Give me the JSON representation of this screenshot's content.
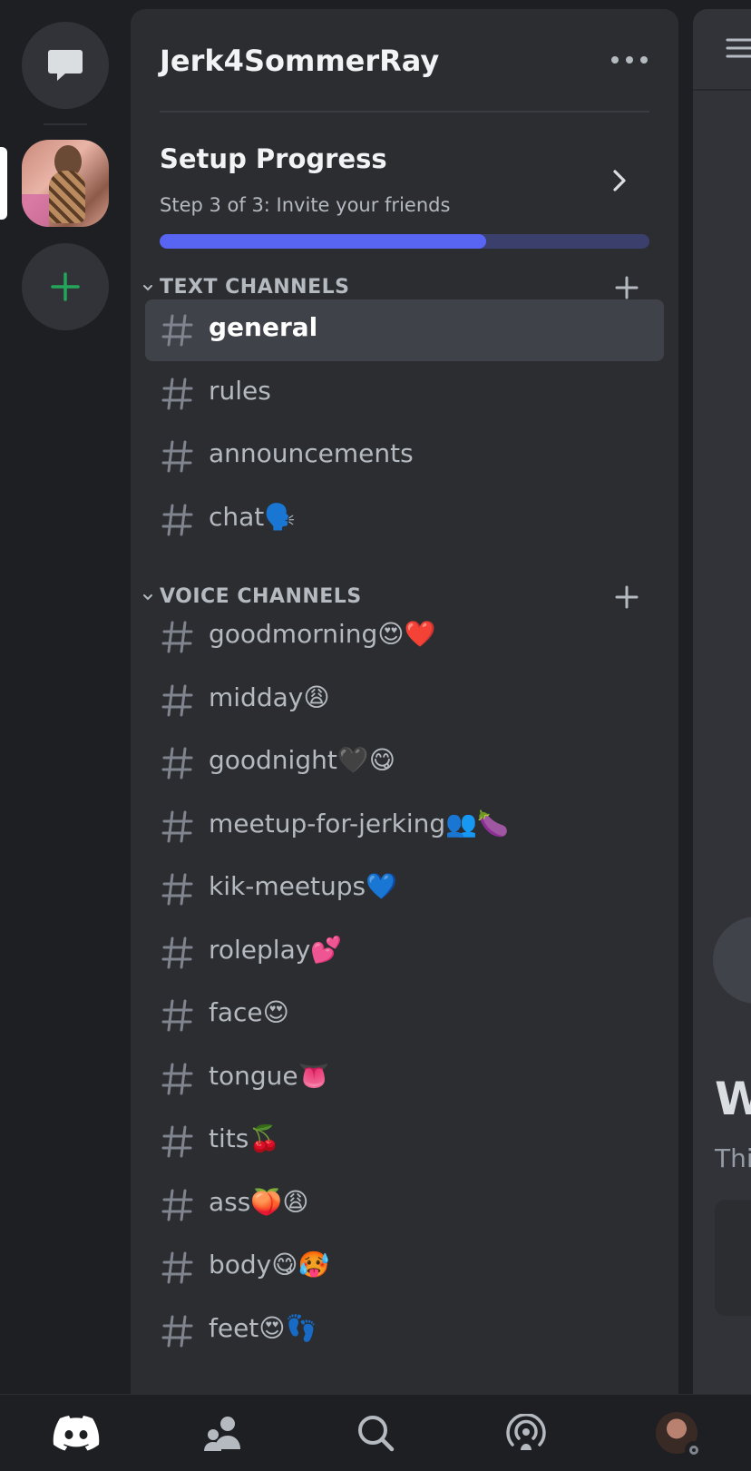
{
  "server": {
    "name": "Jerk4SommerRay",
    "setup": {
      "title": "Setup Progress",
      "subtitle": "Step 3 of 3: Invite your friends",
      "progress": 0.667
    }
  },
  "categories": {
    "text": {
      "label": "TEXT CHANNELS",
      "channels": [
        {
          "name": "general",
          "active": true
        },
        {
          "name": "rules"
        },
        {
          "name": "announcements"
        },
        {
          "name": "chat🗣️"
        }
      ]
    },
    "voice": {
      "label": "VOICE CHANNELS",
      "channels": [
        {
          "name": "goodmorning😍❤️"
        },
        {
          "name": "midday😩"
        },
        {
          "name": "goodnight🖤😋"
        },
        {
          "name": "meetup-for-jerking👥🍆"
        },
        {
          "name": "kik-meetups💙"
        },
        {
          "name": "roleplay💕"
        },
        {
          "name": "face😍"
        },
        {
          "name": "tongue👅"
        },
        {
          "name": "tits🍒"
        },
        {
          "name": "ass🍑😩"
        },
        {
          "name": "body😋🥵"
        },
        {
          "name": "feet😍👣"
        }
      ]
    }
  },
  "chat_peek": {
    "heading_fragment": "W",
    "text_fragment": "Thi"
  },
  "colors": {
    "accent": "#5865f2",
    "add_server_green": "#23a55a"
  },
  "nav": [
    "discord-home-icon",
    "friends-icon",
    "search-icon",
    "mentions-icon",
    "profile-avatar"
  ]
}
